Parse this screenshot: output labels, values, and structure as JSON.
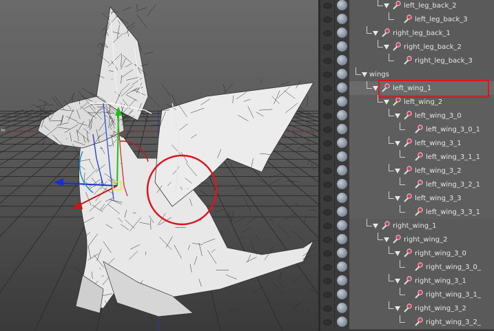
{
  "outliner": {
    "rows": [
      {
        "label": "left_leg_back_2",
        "depth": 5,
        "expanded": true
      },
      {
        "label": "left_leg_back_3",
        "depth": 6,
        "expanded": false
      },
      {
        "label": "right_leg_back_1",
        "depth": 4,
        "expanded": true
      },
      {
        "label": "right_leg_back_2",
        "depth": 5,
        "expanded": true
      },
      {
        "label": "right_leg_back_3",
        "depth": 6,
        "expanded": false
      },
      {
        "label": "wings",
        "depth": 3,
        "expanded": true,
        "icon": "none"
      },
      {
        "label": "left_wing_1",
        "depth": 4,
        "expanded": true,
        "selected": true
      },
      {
        "label": "left_wing_2",
        "depth": 5,
        "expanded": true
      },
      {
        "label": "left_wing_3_0",
        "depth": 6,
        "expanded": true
      },
      {
        "label": "left_wing_3_0_1",
        "depth": 7,
        "expanded": false
      },
      {
        "label": "left_wing_3_1",
        "depth": 6,
        "expanded": true
      },
      {
        "label": "left_wing_3_1_1",
        "depth": 7,
        "expanded": false
      },
      {
        "label": "left_wing_3_2",
        "depth": 6,
        "expanded": true
      },
      {
        "label": "left_wing_3_2_1",
        "depth": 7,
        "expanded": false
      },
      {
        "label": "left_wing_3_3",
        "depth": 6,
        "expanded": true
      },
      {
        "label": "left_wing_3_3_1",
        "depth": 7,
        "expanded": false
      },
      {
        "label": "right_wing_1",
        "depth": 4,
        "expanded": true
      },
      {
        "label": "right_wing_2",
        "depth": 5,
        "expanded": true
      },
      {
        "label": "right_wing_3_0",
        "depth": 6,
        "expanded": true
      },
      {
        "label": "right_wing_3_0_",
        "depth": 7,
        "expanded": false
      },
      {
        "label": "right_wing_3_1",
        "depth": 6,
        "expanded": true
      },
      {
        "label": "right_wing_3_1_",
        "depth": 7,
        "expanded": false
      },
      {
        "label": "right_wing_3_2",
        "depth": 6,
        "expanded": true
      },
      {
        "label": "right_wing_3_2_",
        "depth": 7,
        "expanded": false
      }
    ]
  },
  "icons": {
    "visibility": "eye-icon",
    "shading": "sphere-icon",
    "joint": "joint-icon",
    "expand": "triangle-down-icon"
  },
  "colors": {
    "selection_highlight": "#e0141c",
    "viewport_bg": "#505050",
    "outliner_lane": "#5a5a5a"
  }
}
